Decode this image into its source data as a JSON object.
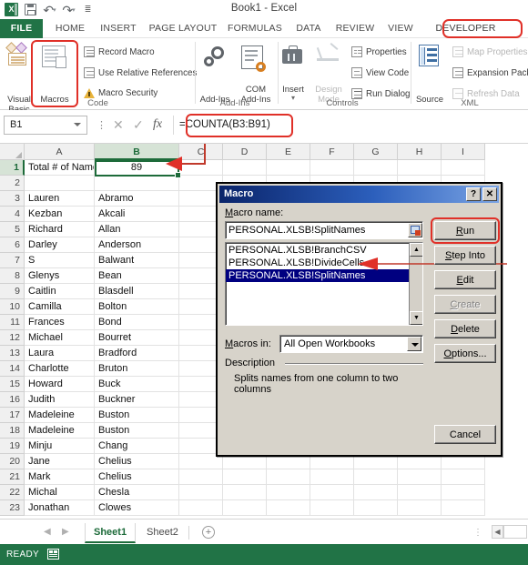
{
  "window": {
    "title": "Book1 - Excel",
    "qat": [
      "excel-logo",
      "save",
      "undo",
      "redo",
      "customize"
    ]
  },
  "ribbon": {
    "tabs": [
      {
        "label": "FILE",
        "active": false
      },
      {
        "label": "HOME",
        "active": false
      },
      {
        "label": "INSERT",
        "active": false
      },
      {
        "label": "PAGE LAYOUT",
        "active": false
      },
      {
        "label": "FORMULAS",
        "active": false
      },
      {
        "label": "DATA",
        "active": false
      },
      {
        "label": "REVIEW",
        "active": false
      },
      {
        "label": "VIEW",
        "active": false
      },
      {
        "label": "DEVELOPER",
        "active": true
      }
    ],
    "groups": [
      {
        "label": "Code"
      },
      {
        "label": "Add-Ins"
      },
      {
        "label": "Controls"
      },
      {
        "label": "XML"
      }
    ],
    "code": {
      "visual_basic": "Visual\nBasic",
      "visual_basic_l1": "Visual",
      "visual_basic_l2": "Basic",
      "macros": "Macros",
      "record_macro": "Record Macro",
      "use_relative_references": "Use Relative References",
      "macro_security": "Macro Security"
    },
    "addins": {
      "add_ins": "Add-Ins",
      "com_add_ins_l1": "COM",
      "com_add_ins_l2": "Add-Ins"
    },
    "controls": {
      "insert": "Insert",
      "design_mode_l1": "Design",
      "design_mode_l2": "Mode",
      "properties": "Properties",
      "view_code": "View Code",
      "run_dialog": "Run Dialog"
    },
    "xml": {
      "source": "Source",
      "map_properties": "Map Properties",
      "expansion_pack": "Expansion Pack",
      "refresh_data": "Refresh Data"
    }
  },
  "formula_bar": {
    "name_box": "B1",
    "formula": "=COUNTA(B3:B91)",
    "cancel_icon": "✕",
    "enter_icon": "✓",
    "fx_icon": "fx"
  },
  "grid": {
    "columns": [
      "A",
      "B",
      "C",
      "D",
      "E",
      "F",
      "G",
      "H",
      "I"
    ],
    "selected_column": "B",
    "selected_row": 1,
    "rows": [
      {
        "n": 1,
        "a": "Total # of Names",
        "b": "89"
      },
      {
        "n": 2,
        "a": "",
        "b": ""
      },
      {
        "n": 3,
        "a": "Lauren",
        "b": "Abramo"
      },
      {
        "n": 4,
        "a": "Kezban",
        "b": "Akcali"
      },
      {
        "n": 5,
        "a": "Richard",
        "b": "Allan"
      },
      {
        "n": 6,
        "a": "Darley",
        "b": "Anderson"
      },
      {
        "n": 7,
        "a": "S",
        "b": "Balwant"
      },
      {
        "n": 8,
        "a": "Glenys",
        "b": "Bean"
      },
      {
        "n": 9,
        "a": "Caitlin",
        "b": "Blasdell"
      },
      {
        "n": 10,
        "a": "Camilla",
        "b": "Bolton"
      },
      {
        "n": 11,
        "a": "Frances",
        "b": "Bond"
      },
      {
        "n": 12,
        "a": "Michael",
        "b": "Bourret"
      },
      {
        "n": 13,
        "a": "Laura",
        "b": "Bradford"
      },
      {
        "n": 14,
        "a": "Charlotte",
        "b": "Bruton"
      },
      {
        "n": 15,
        "a": "Howard",
        "b": "Buck"
      },
      {
        "n": 16,
        "a": "Judith",
        "b": "Buckner"
      },
      {
        "n": 17,
        "a": "Madeleine",
        "b": "Buston"
      },
      {
        "n": 18,
        "a": "Madeleine",
        "b": "Buston"
      },
      {
        "n": 19,
        "a": "Minju",
        "b": "Chang"
      },
      {
        "n": 20,
        "a": "Jane",
        "b": "Chelius"
      },
      {
        "n": 21,
        "a": "Mark",
        "b": "Chelius"
      },
      {
        "n": 22,
        "a": "Michal",
        "b": "Chesla"
      },
      {
        "n": 23,
        "a": "Jonathan",
        "b": "Clowes"
      }
    ]
  },
  "macro_dialog": {
    "title": "Macro",
    "help_button": "?",
    "close_button": "✕",
    "macro_name_label": "Macro name:",
    "macro_name_value": "PERSONAL.XLSB!SplitNames",
    "macro_list": [
      "PERSONAL.XLSB!BranchCSV",
      "PERSONAL.XLSB!DivideCells",
      "PERSONAL.XLSB!SplitNames"
    ],
    "selected_macro": "PERSONAL.XLSB!SplitNames",
    "buttons": [
      {
        "label": "Run",
        "enabled": true,
        "highlighted": true
      },
      {
        "label": "Step Into",
        "enabled": true,
        "highlighted": false
      },
      {
        "label": "Edit",
        "enabled": true,
        "highlighted": false
      },
      {
        "label": "Create",
        "enabled": false,
        "highlighted": false
      },
      {
        "label": "Delete",
        "enabled": true,
        "highlighted": false
      },
      {
        "label": "Options...",
        "enabled": true,
        "highlighted": false
      }
    ],
    "cancel_button": "Cancel",
    "macros_in_label": "Macros in:",
    "macros_in_value": "All Open Workbooks",
    "description_label": "Description",
    "description_text": "Splits names from one column to two columns"
  },
  "sheet_tabs": {
    "tabs": [
      {
        "label": "Sheet1",
        "active": true
      },
      {
        "label": "Sheet2",
        "active": false
      }
    ],
    "add_sheet": "+",
    "prev_icon": "◀",
    "next_icon": "▶"
  },
  "status_bar": {
    "state": "READY",
    "macro_record_icon": "record-macro-icon"
  },
  "colors": {
    "excel_green": "#217346",
    "annotation_red": "#e03028",
    "selection_green": "#1d6b3a",
    "dialog_titlebar": "#0a246a",
    "list_selection": "#000080"
  }
}
